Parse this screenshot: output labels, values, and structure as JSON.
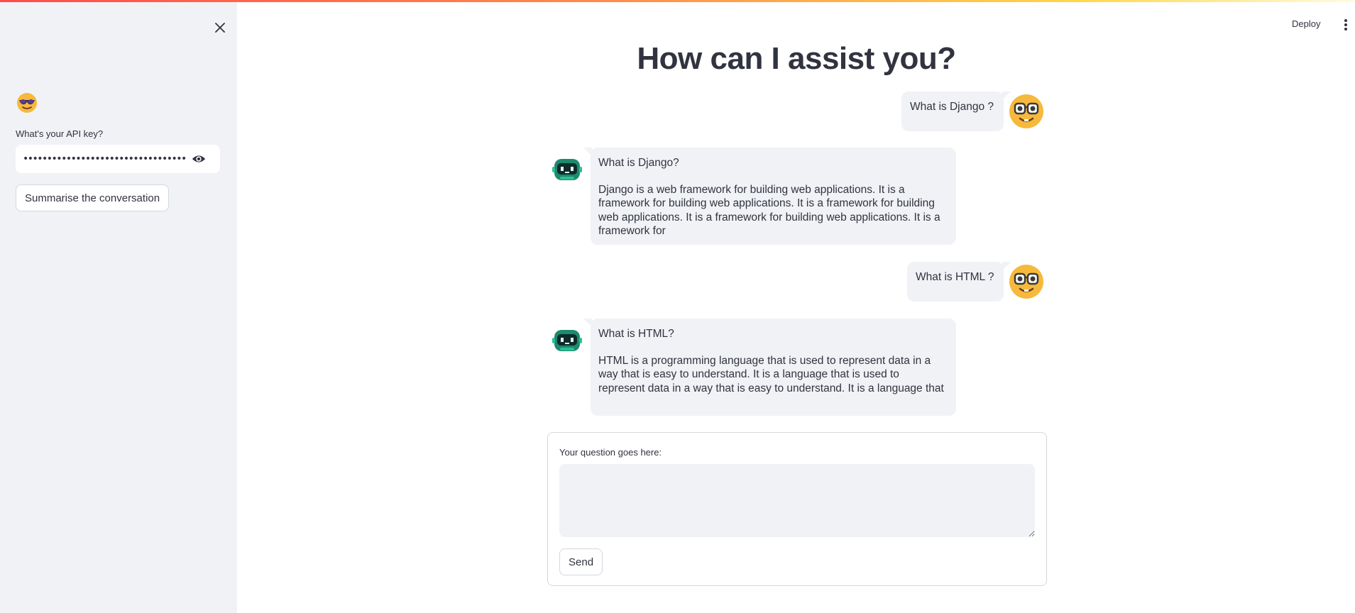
{
  "sidebar": {
    "api_key_label": "What's your API key?",
    "api_key_value": "••••••••••••••••••••••••••••••••••••••",
    "summarise_label": "Summarise the conversation"
  },
  "header": {
    "deploy_label": "Deploy"
  },
  "main": {
    "title": "How can I assist you?",
    "messages": [
      {
        "role": "user",
        "text": "What is Django ?"
      },
      {
        "role": "assistant",
        "question": "What is Django?",
        "answer": "Django is a web framework for building web applications. It is a framework for building web applications. It is a framework for building web applications. It is a framework for building web applications. It is a framework for"
      },
      {
        "role": "user",
        "text": "What is HTML ?"
      },
      {
        "role": "assistant",
        "question": "What is HTML?",
        "answer": "HTML is a programming language that is used to represent data in a way that is easy to understand. It is a language that is used to represent data in a way that is easy to understand. It is a language that"
      }
    ]
  },
  "form": {
    "question_label": "Your question goes here:",
    "question_value": "",
    "send_label": "Send"
  },
  "colors": {
    "accent": "#ff4b4b",
    "sidebar_bg": "#f0f2f6",
    "bubble_bg": "#f0f2f6",
    "text": "#31333f"
  },
  "icons": {
    "close": "close-icon",
    "sidebar_emoji": "sunglasses-face-icon",
    "eye": "eye-icon",
    "user_avatar": "nerd-face-icon",
    "assistant_avatar": "robot-icon",
    "menu": "kebab-menu-icon"
  }
}
